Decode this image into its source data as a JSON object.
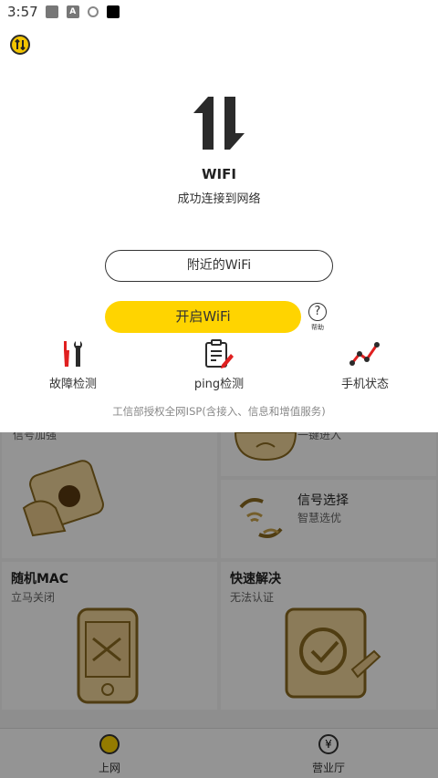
{
  "status_bar": {
    "time": "3:57",
    "icons": [
      "gray-square-icon",
      "a-badge-icon",
      "shield-icon",
      "black-square-icon"
    ],
    "a_icon_text": "A"
  },
  "popup": {
    "title": "WIFI",
    "subtitle": "成功连接到网络",
    "nearby_button": "附近的WiFi",
    "open_wifi_button": "开启WiFi",
    "help_symbol": "?",
    "help_label": "帮助",
    "tools": [
      {
        "label": "故障检测",
        "icon": "tools-icon"
      },
      {
        "label": "ping检测",
        "icon": "clipboard-pen-icon"
      },
      {
        "label": "手机状态",
        "icon": "trend-chart-icon"
      }
    ],
    "license_text": "工信部授权全网ISP(含接入、信息和增值服务)",
    "accent_color": "#ffd400"
  },
  "background": {
    "tiles": [
      {
        "title": "",
        "subtitle": "信号加强"
      },
      {
        "title": "",
        "subtitle": "一键进入"
      },
      {
        "title": "信号选择",
        "subtitle": "智慧选优"
      },
      {
        "title": "随机MAC",
        "subtitle": "立马关闭"
      },
      {
        "title": "快速解决",
        "subtitle": "无法认证"
      }
    ],
    "tabs": [
      {
        "label": "上网",
        "icon": "wifi-tab-icon"
      },
      {
        "label": "营业厅",
        "icon": "yuan-tab-icon"
      }
    ]
  }
}
